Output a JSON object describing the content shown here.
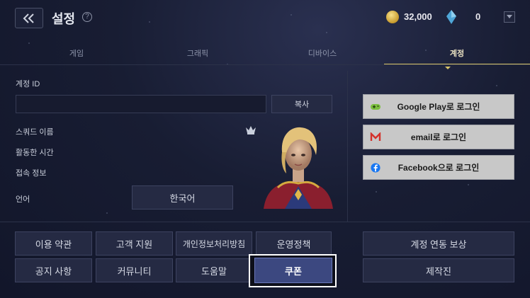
{
  "header": {
    "title": "설정",
    "help": "?",
    "gold": "32,000",
    "gems": "0"
  },
  "tabs": [
    {
      "label": "게임"
    },
    {
      "label": "그래픽"
    },
    {
      "label": "디바이스"
    },
    {
      "label": "계정"
    }
  ],
  "account": {
    "id_label": "계정 ID",
    "copy_button": "복사",
    "squad_name_label": "스쿼드 이름",
    "active_time_label": "활동한 시간",
    "connection_label": "접속 정보",
    "language_label": "언어",
    "language_value": "한국어"
  },
  "login": [
    {
      "label": "Google Play로 로그인",
      "icon": "gamepad-icon"
    },
    {
      "label": "email로 로그인",
      "icon": "gmail-icon"
    },
    {
      "label": "Facebook으로 로그인",
      "icon": "facebook-icon"
    }
  ],
  "bottom_buttons": {
    "terms": "이용 약관",
    "support": "고객 지원",
    "privacy": "개인정보처리방침",
    "policy": "운영정책",
    "notice": "공지 사항",
    "community": "커뮤니티",
    "help": "도움말",
    "coupon": "쿠폰",
    "link_reward": "계정 연동 보상",
    "credits": "제작진"
  },
  "colors": {
    "accent": "#d7c46a",
    "coupon_bg": "#3c4880"
  }
}
